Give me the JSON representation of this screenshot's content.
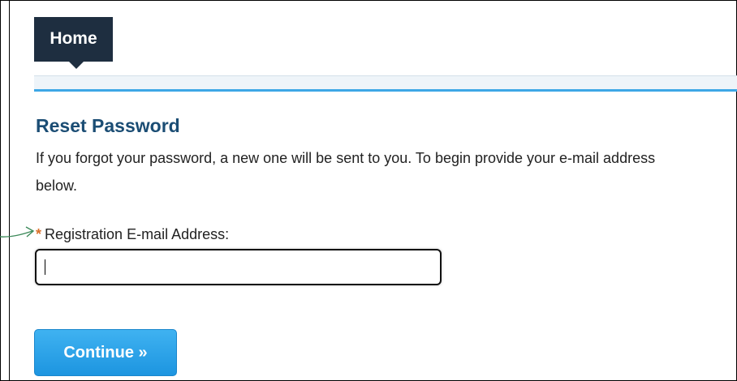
{
  "nav": {
    "home_tab": "Home"
  },
  "page": {
    "title": "Reset Password",
    "instructions": "If you forgot your password, a new one will be sent to you. To begin provide your e-mail address below."
  },
  "form": {
    "required_marker": "*",
    "email_label": "Registration E-mail Address:",
    "email_value": "",
    "continue_label": "Continue »"
  },
  "colors": {
    "nav_tab_bg": "#1e2e40",
    "nav_accent_line": "#3da7e6",
    "title": "#1b4d74",
    "required_star": "#d9702a",
    "button": "#2aa3ea",
    "annotation_arrow": "#3d8a5a"
  },
  "icons": {
    "annotation": "arrow-right-icon"
  }
}
